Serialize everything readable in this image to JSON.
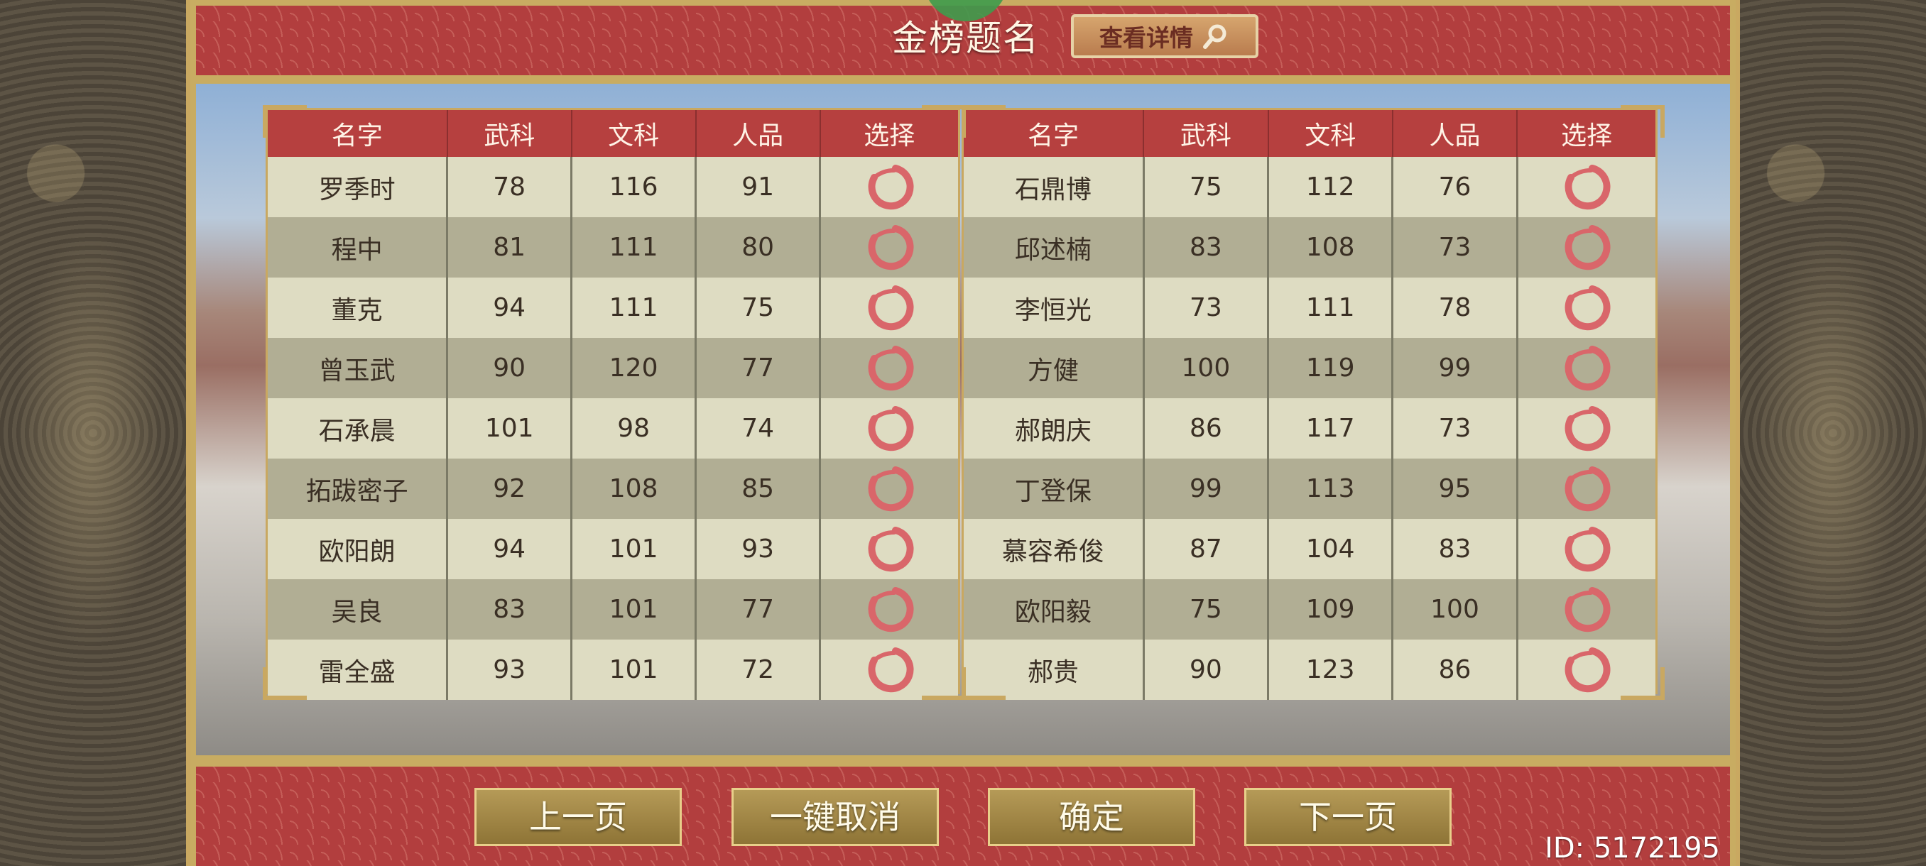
{
  "header": {
    "title": "金榜题名",
    "detail_button": "查看详情"
  },
  "table_left": {
    "columns": [
      "名字",
      "武科",
      "文科",
      "人品",
      "选择"
    ],
    "rows": [
      [
        "罗季时",
        "78",
        "116",
        "91"
      ],
      [
        "程中",
        "81",
        "111",
        "80"
      ],
      [
        "董克",
        "94",
        "111",
        "75"
      ],
      [
        "曾玉武",
        "90",
        "120",
        "77"
      ],
      [
        "石承晨",
        "101",
        "98",
        "74"
      ],
      [
        "拓跋密子",
        "92",
        "108",
        "85"
      ],
      [
        "欧阳朗",
        "94",
        "101",
        "93"
      ],
      [
        "吴良",
        "83",
        "101",
        "77"
      ],
      [
        "雷全盛",
        "93",
        "101",
        "72"
      ]
    ]
  },
  "table_right": {
    "columns": [
      "名字",
      "武科",
      "文科",
      "人品",
      "选择"
    ],
    "rows": [
      [
        "石鼎博",
        "75",
        "112",
        "76"
      ],
      [
        "邱述楠",
        "83",
        "108",
        "73"
      ],
      [
        "李恒光",
        "73",
        "111",
        "78"
      ],
      [
        "方健",
        "100",
        "119",
        "99"
      ],
      [
        "郝朗庆",
        "86",
        "117",
        "73"
      ],
      [
        "丁登保",
        "99",
        "113",
        "95"
      ],
      [
        "慕容希俊",
        "87",
        "104",
        "83"
      ],
      [
        "欧阳毅",
        "75",
        "109",
        "100"
      ],
      [
        "郝贵",
        "90",
        "123",
        "86"
      ]
    ]
  },
  "buttons": {
    "prev": "上一页",
    "cancel_all": "一键取消",
    "confirm": "确定",
    "next": "下一页"
  },
  "user_id": "ID: 5172195",
  "colors": {
    "banner_red": "#b23e3e",
    "gold": "#c9a861",
    "ring_red": "#d9666a"
  },
  "icons": {
    "select_marker": "brush-circle-icon",
    "detail": "magnifier-icon"
  }
}
